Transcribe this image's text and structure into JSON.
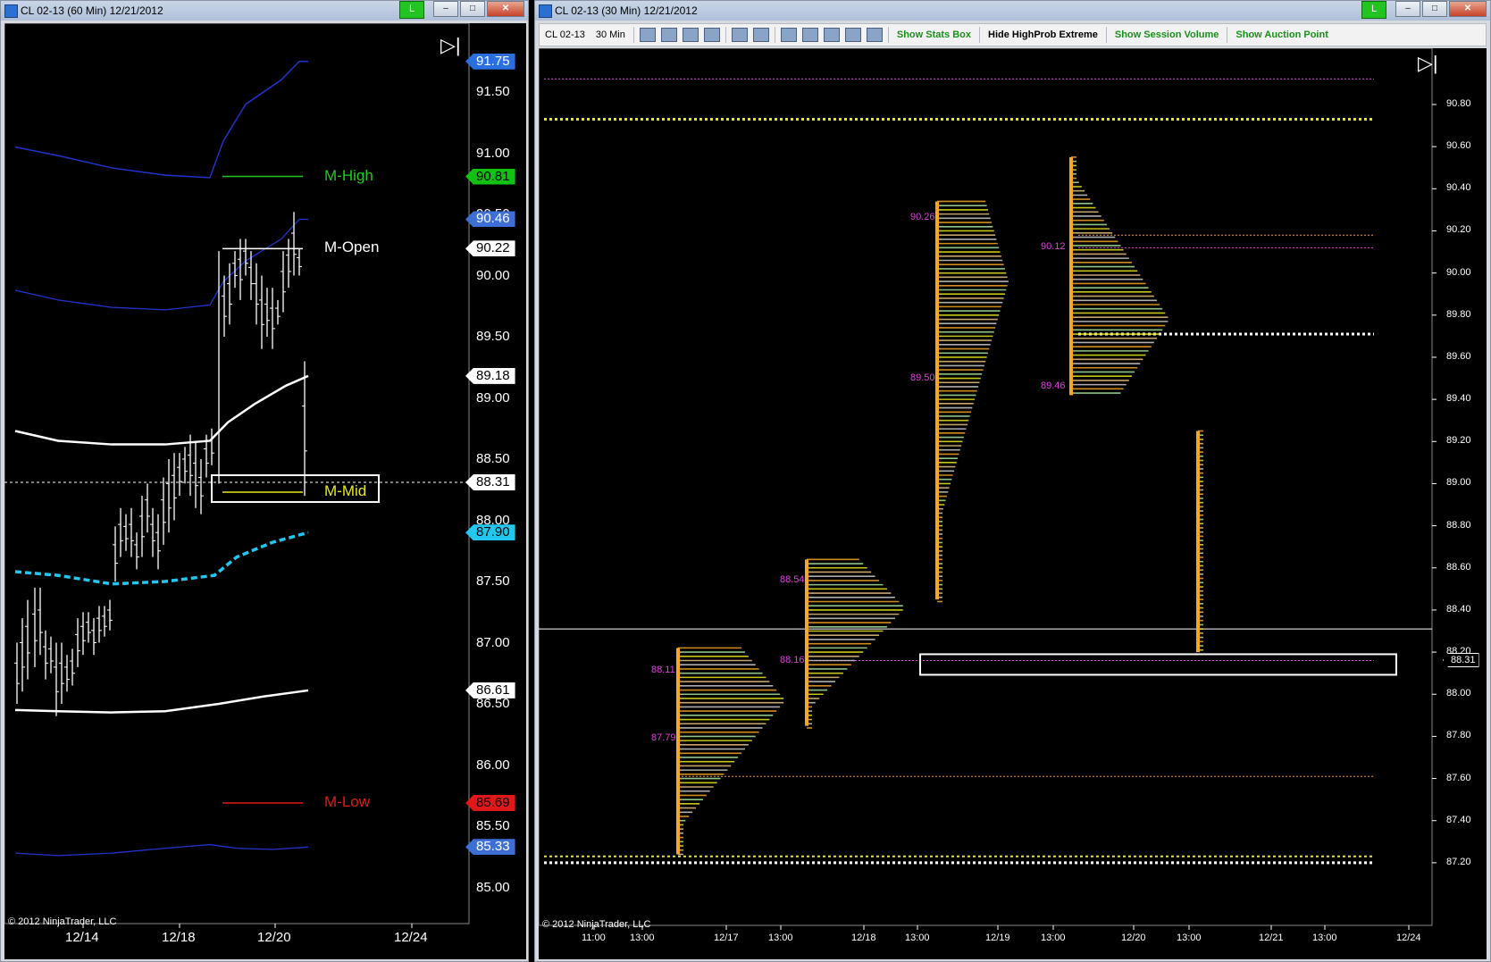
{
  "left_window": {
    "title": "CL 02-13 (60 Min)  12/21/2012",
    "live_badge": "L",
    "sys_buttons": {
      "minimize": "–",
      "maximize": "□",
      "close": "✕"
    },
    "y_axis": [
      "91.50",
      "91.00",
      "90.50",
      "90.00",
      "89.50",
      "89.00",
      "88.50",
      "88.00",
      "87.50",
      "87.00",
      "86.50",
      "86.00",
      "85.50",
      "85.00"
    ],
    "x_axis": [
      "12/14",
      "12/18",
      "12/20",
      "12/24"
    ],
    "price_tags": [
      {
        "value": "91.75",
        "bg": "#2a6fe0",
        "fg": "#ffffff"
      },
      {
        "value": "90.81",
        "bg": "#12c212",
        "fg": "#000000"
      },
      {
        "value": "90.46",
        "bg": "#3d6fd6",
        "fg": "#ffffff"
      },
      {
        "value": "90.22",
        "bg": "#ffffff",
        "fg": "#000000"
      },
      {
        "value": "89.18",
        "bg": "#ffffff",
        "fg": "#000000"
      },
      {
        "value": "88.31",
        "bg": "#ffffff",
        "fg": "#000000"
      },
      {
        "value": "87.90",
        "bg": "#22c7f0",
        "fg": "#000000"
      },
      {
        "value": "86.61",
        "bg": "#ffffff",
        "fg": "#000000"
      },
      {
        "value": "85.69",
        "bg": "#e01818",
        "fg": "#000000"
      },
      {
        "value": "85.33",
        "bg": "#3d6fd6",
        "fg": "#ffffff"
      }
    ],
    "levels": [
      {
        "name": "M-High",
        "price": 90.81,
        "color": "#1ecc1e"
      },
      {
        "name": "M-Open",
        "price": 90.22,
        "color": "#ffffff"
      },
      {
        "name": "M-Mid",
        "price": 88.23,
        "color": "#e8e81c"
      },
      {
        "name": "M-Low",
        "price": 85.69,
        "color": "#e01818"
      }
    ],
    "last_price": 88.31,
    "copyright": "© 2012 NinjaTrader, LLC",
    "colors": {
      "band": "#2233cc",
      "vwap": "#ffffff",
      "ma": "#22c7f0",
      "bars": "#ffffff"
    }
  },
  "right_window": {
    "title": "CL 02-13 (30 Min)  12/21/2012",
    "live_badge": "L",
    "sys_buttons": {
      "minimize": "–",
      "maximize": "□",
      "close": "✕"
    },
    "toolbar": {
      "instrument": "CL 02-13",
      "interval": "30 Min",
      "buttons": [
        "Show Stats Box",
        "Hide HighProb Extreme",
        "Show Session Volume",
        "Show Auction Point"
      ]
    },
    "y_axis": [
      "90.80",
      "90.60",
      "90.40",
      "90.20",
      "90.00",
      "89.80",
      "89.60",
      "89.40",
      "89.20",
      "89.00",
      "88.80",
      "88.60",
      "88.40",
      "88.20",
      "88.00",
      "87.80",
      "87.60",
      "87.40",
      "87.20"
    ],
    "x_axis": [
      "11:00",
      "13:00",
      "12/17",
      "13:00",
      "12/18",
      "13:00",
      "12/19",
      "13:00",
      "12/20",
      "13:00",
      "12/21",
      "13:00",
      "12/24"
    ],
    "last_price_tag": "88.31",
    "profile_labels": [
      "88.11",
      "87.79",
      "88.54",
      "88.16",
      "90.26",
      "89.50",
      "90.12",
      "89.46"
    ],
    "copyright": "© 2012 NinjaTrader, LLC",
    "colors": {
      "magenta": "#e040e0",
      "orange": "#f5a623",
      "yellow": "#e8e81c",
      "green": "#a8e6a0"
    }
  }
}
